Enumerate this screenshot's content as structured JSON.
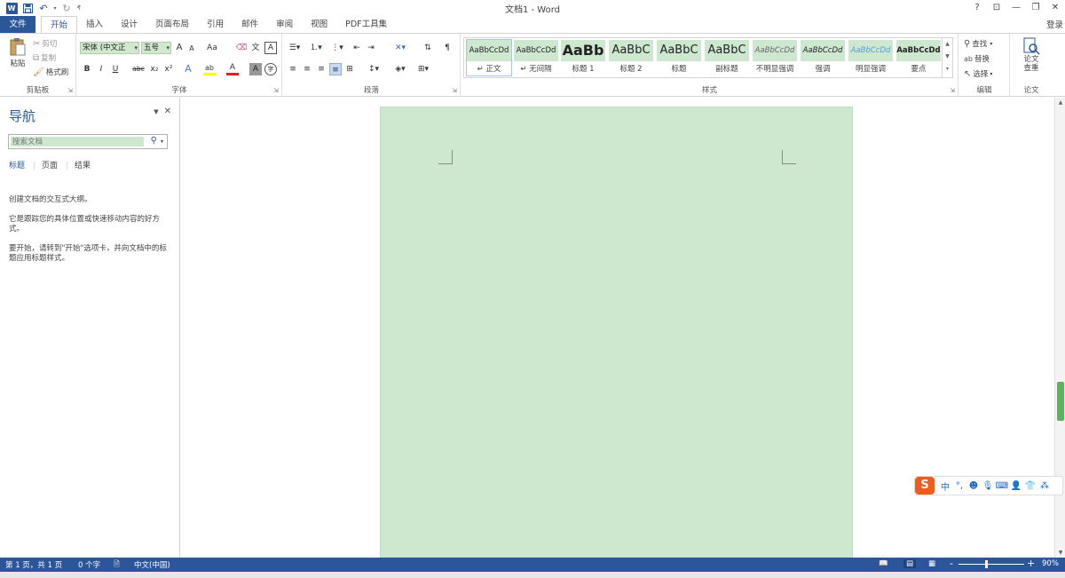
{
  "window": {
    "title": "文档1 - Word",
    "controls": [
      "?",
      "⊡",
      "—",
      "❐",
      "✕"
    ],
    "login_label": "登录"
  },
  "qat": {
    "app_icon": "W",
    "save_icon": "save-icon",
    "undo_icon": "undo-icon",
    "redo_icon": "redo-icon",
    "customize_icon": "customize-icon"
  },
  "tabs": [
    {
      "label": "文件",
      "type": "file"
    },
    {
      "label": "开始",
      "active": true
    },
    {
      "label": "插入"
    },
    {
      "label": "设计"
    },
    {
      "label": "页面布局"
    },
    {
      "label": "引用"
    },
    {
      "label": "邮件"
    },
    {
      "label": "审阅"
    },
    {
      "label": "视图"
    },
    {
      "label": "PDF工具集"
    }
  ],
  "ribbon": {
    "clipboard": {
      "label": "剪贴板",
      "paste": "粘贴",
      "cut": "剪切",
      "copy": "复制",
      "format_painter": "格式刷"
    },
    "font": {
      "label": "字体",
      "font_name": "宋体 (中文正",
      "font_size": "五号",
      "grow": "A",
      "shrink": "A",
      "case": "Aa",
      "bold": "B",
      "italic": "I",
      "underline": "U",
      "strike": "abc",
      "subscript": "x₂",
      "superscript": "x²",
      "effects": "A",
      "highlight": "ab",
      "font_color": "A",
      "char_shading": "A",
      "enclose": "字"
    },
    "paragraph": {
      "label": "段落"
    },
    "styles": {
      "label": "样式",
      "items": [
        {
          "preview": "AaBbCcDd",
          "name": "正文",
          "selected": true
        },
        {
          "preview": "AaBbCcDd",
          "name": "无间隔"
        },
        {
          "preview": "AaBb",
          "name": "标题 1"
        },
        {
          "preview": "AaBbC",
          "name": "标题 2"
        },
        {
          "preview": "AaBbC",
          "name": "标题"
        },
        {
          "preview": "AaBbC",
          "name": "副标题"
        },
        {
          "preview": "AaBbCcDd",
          "name": "不明显强调"
        },
        {
          "preview": "AaBbCcDd",
          "name": "强调"
        },
        {
          "preview": "AaBbCcDd",
          "name": "明显强调"
        },
        {
          "preview": "AaBbCcDd",
          "name": "要点"
        }
      ]
    },
    "editing": {
      "label": "编辑",
      "find": "查找",
      "replace": "替换",
      "select": "选择"
    },
    "paper": {
      "label": "论文",
      "check": "论文查重"
    }
  },
  "nav": {
    "title": "导航",
    "search_placeholder": "搜索文档",
    "tabs": [
      "标题",
      "页面",
      "结果"
    ],
    "lines": [
      "创建文档的交互式大纲。",
      "它是跟踪您的具体位置或快速移动内容的好方式。",
      "要开始，请转到\"开始\"选项卡，并向文档中的标题应用标题样式。"
    ]
  },
  "status": {
    "page": "第 1 页，共 1 页",
    "words": "0 个字",
    "language": "中文(中国)",
    "zoom": "90%",
    "zoom_minus": "-",
    "zoom_plus": "+"
  },
  "ime": {
    "logo": "S",
    "mode": "中",
    "punct": "°,"
  },
  "colors": {
    "accent": "#2b579a",
    "page_bg": "#cde8cf",
    "ime_orange": "#ef5b1e"
  }
}
